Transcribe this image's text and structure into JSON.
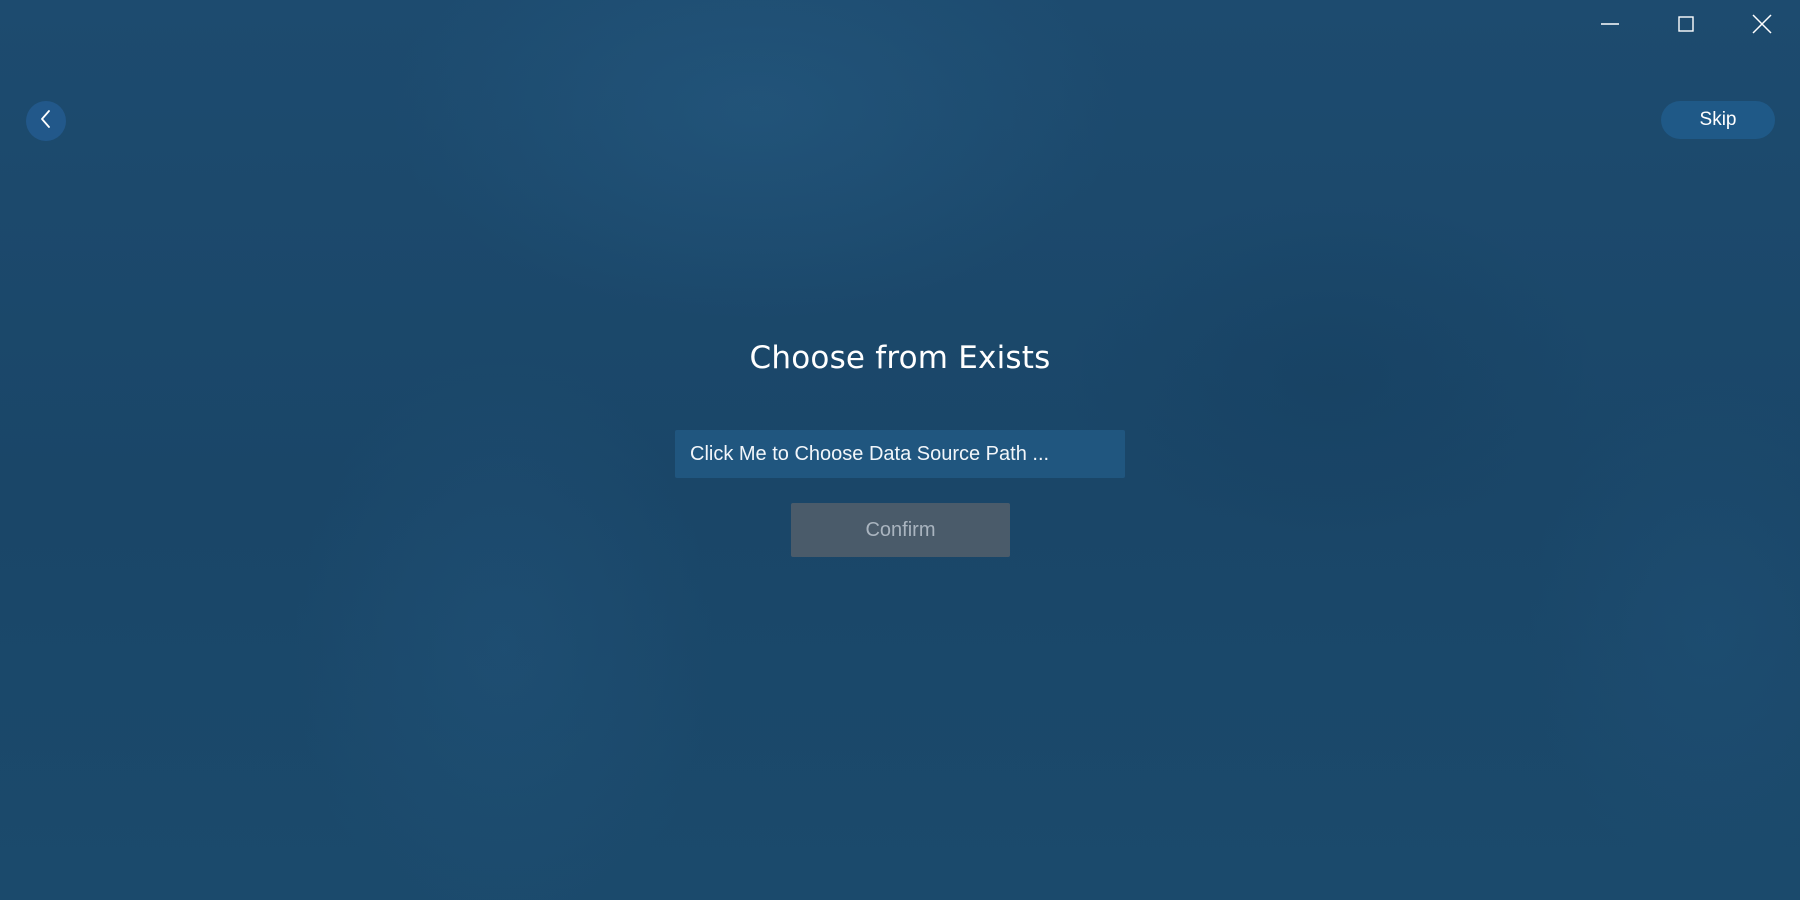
{
  "window_controls": {
    "minimize_icon": "minimize-icon",
    "maximize_icon": "maximize-icon",
    "close_icon": "close-icon"
  },
  "nav": {
    "back_icon": "chevron-left-icon",
    "skip_label": "Skip"
  },
  "main": {
    "title": "Choose from Exists",
    "path_chooser_label": "Click Me to Choose Data Source Path ...",
    "confirm_label": "Confirm",
    "confirm_enabled": false
  },
  "colors": {
    "background": "#1b4a6d",
    "button_fill": "#1f5987",
    "path_chooser_fill": "#20567f",
    "confirm_disabled_fill": "#4a5b6a",
    "confirm_disabled_text": "#a9b4bf"
  }
}
